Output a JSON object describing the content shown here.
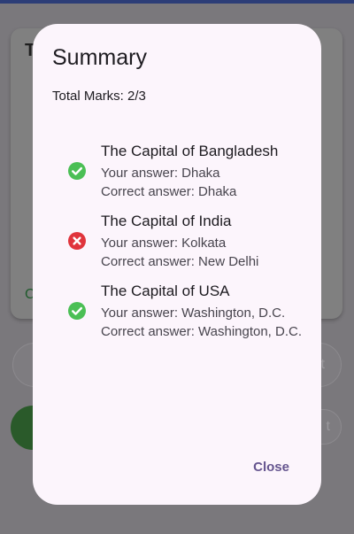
{
  "background": {
    "card_title_fragment": "T",
    "card_option_fragment": "C",
    "pill_label_fragment": "t",
    "right_button_fragment": "t"
  },
  "dialog": {
    "title": "Summary",
    "total_marks": "Total Marks: 2/3",
    "results": [
      {
        "question": "The Capital of Bangladesh",
        "your_answer": "Your answer: Dhaka",
        "correct_answer": "Correct answer: Dhaka",
        "status": "correct",
        "icon": "check-circle-icon"
      },
      {
        "question": "The Capital of India",
        "your_answer": "Your answer: Kolkata",
        "correct_answer": "Correct answer: New Delhi",
        "status": "incorrect",
        "icon": "cancel-circle-icon"
      },
      {
        "question": "The Capital of USA",
        "your_answer": "Your answer: Washington, D.C.",
        "correct_answer": "Correct answer: Washington, D.C.",
        "status": "correct",
        "icon": "check-circle-icon"
      }
    ],
    "close_label": "Close"
  },
  "colors": {
    "correct": "#4bbf55",
    "incorrect": "#e0343c",
    "accent": "#65558f",
    "dialog_bg": "#fcf5fc",
    "scrim": "#7a787c"
  }
}
